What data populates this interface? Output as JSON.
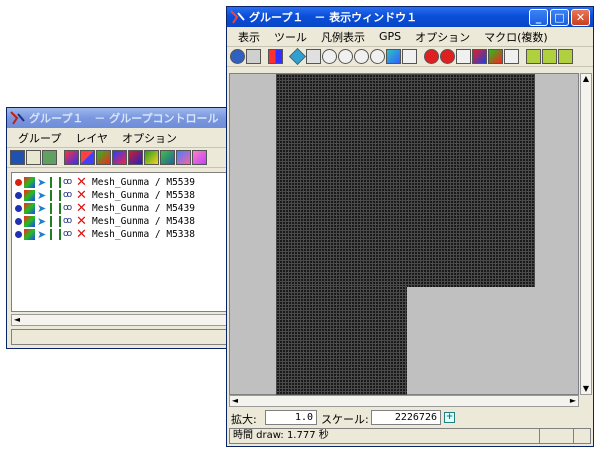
{
  "group_control": {
    "title": "グループ１　－ グループコントロール",
    "menu": [
      "グループ",
      "レイヤ",
      "オプション"
    ],
    "layers": [
      {
        "name": "Mesh_Gunma / M5539",
        "active": true
      },
      {
        "name": "Mesh_Gunma / M5538",
        "active": false
      },
      {
        "name": "Mesh_Gunma / M5439",
        "active": false
      },
      {
        "name": "Mesh_Gunma / M5438",
        "active": false
      },
      {
        "name": "Mesh_Gunma / M5338",
        "active": false
      }
    ]
  },
  "display_window": {
    "title": "グループ１　－ 表示ウィンドウ１",
    "menu": [
      "表示",
      "ツール",
      "凡例表示",
      "GPS",
      "オプション",
      "マクロ(複数)"
    ],
    "zoom_label": "拡大:",
    "zoom_value": "1.0",
    "scale_label": "スケール:",
    "scale_value": "2226726",
    "status_text": "時間 draw: 1.777 秒"
  },
  "colors": {
    "title_active": "#0a4fd8",
    "title_inactive": "#7a96df",
    "window_bg": "#ece9d8",
    "map_bg": "#c0c0c0",
    "mesh": "#1a1a1a"
  }
}
